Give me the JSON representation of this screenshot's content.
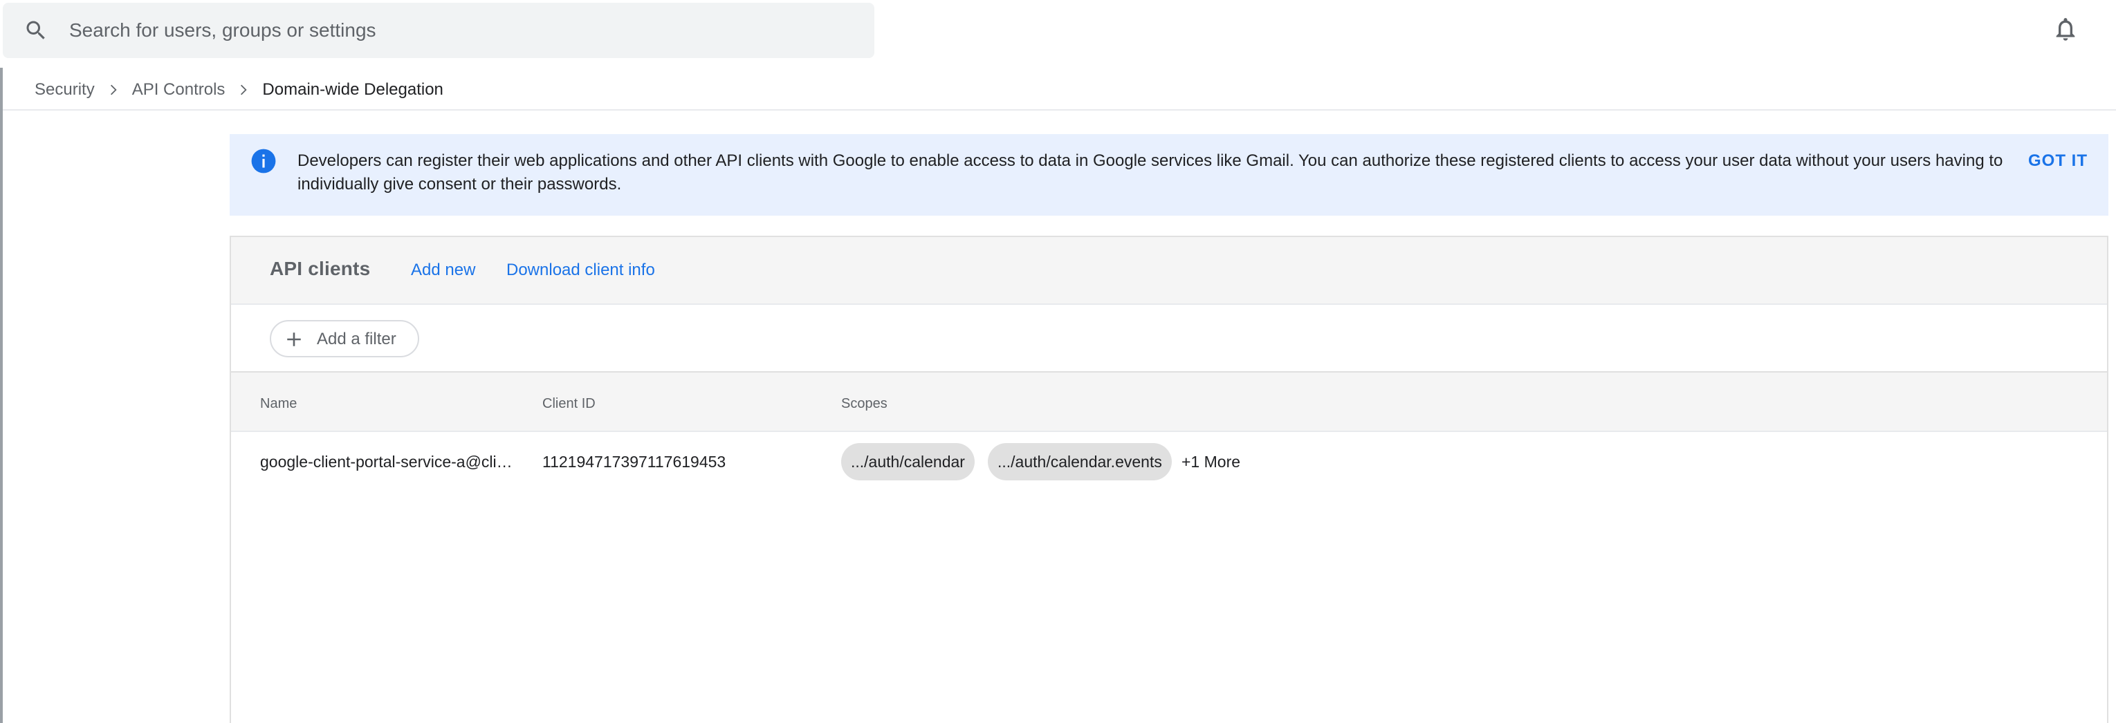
{
  "search": {
    "placeholder": "Search for users, groups or settings",
    "icon": "search-icon"
  },
  "header": {
    "notifications_icon": "bell-icon"
  },
  "breadcrumb": {
    "items": [
      "Security",
      "API Controls",
      "Domain-wide Delegation"
    ]
  },
  "banner": {
    "text": "Developers can register their web applications and other API clients with Google to enable access to data in Google services like Gmail. You can authorize these registered clients to access your user data without your users having to individually give consent or their passwords.",
    "action": "GOT IT"
  },
  "api_clients": {
    "title": "API clients",
    "add_new": "Add new",
    "download": "Download client info",
    "filter_label": "Add a filter",
    "columns": [
      "Name",
      "Client ID",
      "Scopes"
    ],
    "rows": [
      {
        "name": "google-client-portal-service-a@clie...",
        "client_id": "112194717397117619453",
        "scopes": [
          ".../auth/calendar",
          ".../auth/calendar.events"
        ],
        "more": "+1 More"
      }
    ]
  },
  "colors": {
    "accent": "#1a73e8",
    "banner_bg": "#e8f0fe",
    "header_bg": "#f5f5f5",
    "chip_bg": "#e0e0e0"
  }
}
